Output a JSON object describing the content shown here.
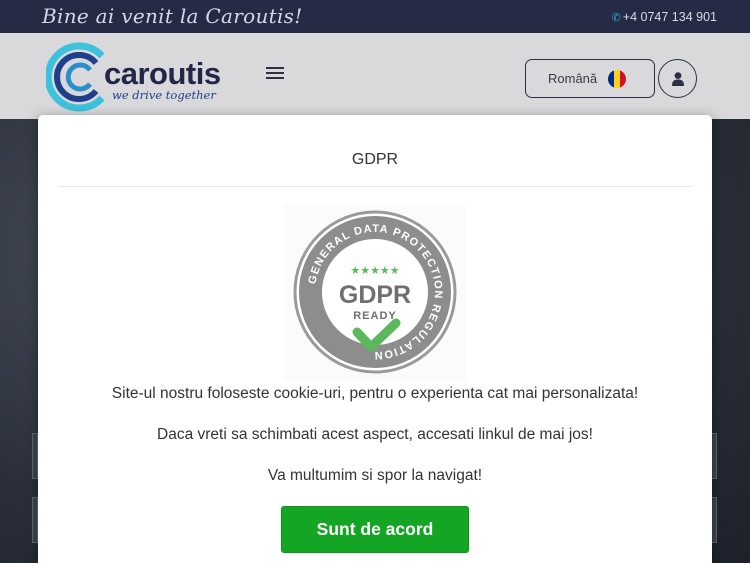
{
  "topbar": {
    "welcome": "Bine ai venit la Caroutis!",
    "phone": "+4 0747 134 901",
    "phone_icon": "phone-icon"
  },
  "header": {
    "logo_name": "caroutis",
    "logo_tagline": "we drive together",
    "menu_icon": "hamburger-icon",
    "language_label": "Română",
    "flag_colors": [
      "#002b7f",
      "#fcd116",
      "#ce1126"
    ],
    "user_icon": "user-icon"
  },
  "modal": {
    "title": "GDPR",
    "badge": {
      "ring_text": "GENERAL DATA PROTECTION REGULATION",
      "stars": "★★★★★",
      "title": "GDPR",
      "subtitle": "READY",
      "check_color": "#5cb85c"
    },
    "line1": "Site-ul nostru foloseste cookie-uri, pentru o experienta cat mai personalizata!",
    "line2": "Daca vreti sa schimbati acest aspect, accesati linkul de mai jos!",
    "line3": "Va multumim si spor la navigat!",
    "agree_button": "Sunt de acord"
  },
  "colors": {
    "topbar_bg": "#262b45",
    "header_bg": "#d9d9dc",
    "brand_blue": "#1f3f8a",
    "accept_green": "#15a524"
  }
}
